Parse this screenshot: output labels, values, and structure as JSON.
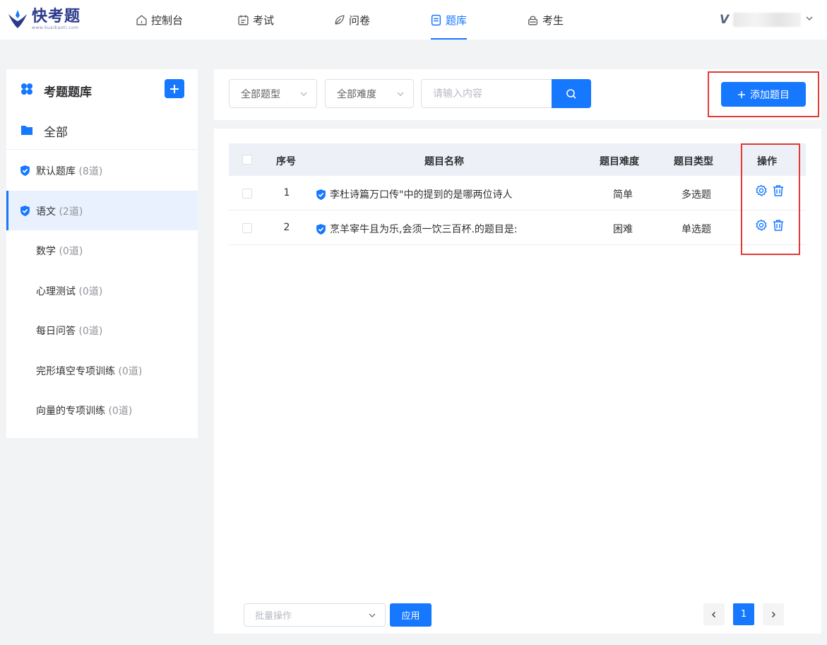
{
  "brand": {
    "name": "快考题",
    "sub": "www.kuaikaoti.com"
  },
  "nav": {
    "items": [
      {
        "label": "控制台",
        "icon": "home-icon"
      },
      {
        "label": "考试",
        "icon": "calendar-icon"
      },
      {
        "label": "问卷",
        "icon": "leaf-icon"
      },
      {
        "label": "题库",
        "icon": "document-icon",
        "active": true
      },
      {
        "label": "考生",
        "icon": "lock-icon"
      }
    ]
  },
  "user": {
    "initial": "V",
    "caret_icon": "chevron-down-icon"
  },
  "sidebar": {
    "title": "考题题库",
    "all_label": "全部",
    "banks": [
      {
        "name": "默认题库",
        "count": "(8道)",
        "verified": true,
        "active": false
      },
      {
        "name": "语文",
        "count": "(2道)",
        "verified": true,
        "active": true
      },
      {
        "name": "数学",
        "count": "(0道)",
        "verified": false,
        "active": false
      },
      {
        "name": "心理测试",
        "count": "(0道)",
        "verified": false,
        "active": false
      },
      {
        "name": "每日问答",
        "count": "(0道)",
        "verified": false,
        "active": false
      },
      {
        "name": "完形填空专项训练",
        "count": "(0道)",
        "verified": false,
        "active": false
      },
      {
        "name": "向量的专项训练",
        "count": "(0道)",
        "verified": false,
        "active": false
      }
    ]
  },
  "filters": {
    "type_select": "全部题型",
    "difficulty_select": "全部难度",
    "search_placeholder": "请输入内容",
    "add_button": "添加题目"
  },
  "table": {
    "headers": {
      "index": "序号",
      "name": "题目名称",
      "difficulty": "题目难度",
      "type": "题目类型",
      "actions": "操作"
    },
    "rows": [
      {
        "index": "1",
        "name": "李杜诗篇万口传\"中的提到的是哪两位诗人",
        "difficulty": "简单",
        "type": "多选题"
      },
      {
        "index": "2",
        "name": "烹羊宰牛且为乐,会须一饮三百杯.的题目是:",
        "difficulty": "困难",
        "type": "单选题"
      }
    ]
  },
  "footer": {
    "batch_placeholder": "批量操作",
    "apply_label": "应用",
    "current_page": "1",
    "prev_icon": "chevron-left-icon",
    "next_icon": "chevron-right-icon"
  },
  "colors": {
    "accent": "#1677ff",
    "highlight": "#e53935"
  }
}
